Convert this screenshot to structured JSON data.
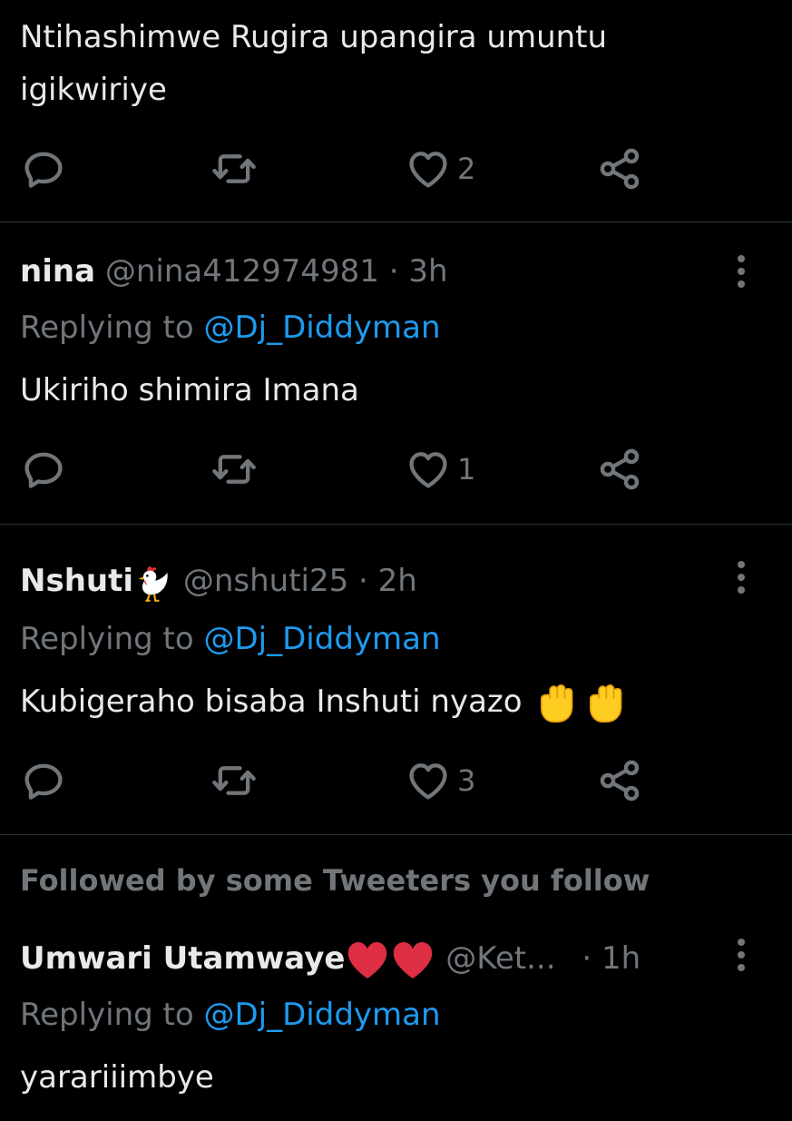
{
  "tweets": [
    {
      "body": "Ntihashimwe Rugira upangira umuntu",
      "body2": "igikwiriye",
      "like_count": "2"
    },
    {
      "name": "nina",
      "handle": "@nina412974981",
      "sep": "·",
      "time": "3h",
      "replying_label": "Replying to",
      "mention": "@Dj_Diddyman",
      "body": "Ukiriho shimira Imana",
      "like_count": "1"
    },
    {
      "name": "Nshuti",
      "name_emoji": "rooster",
      "handle": "@nshuti25",
      "sep": "·",
      "time": "2h",
      "replying_label": "Replying to",
      "mention": "@Dj_Diddyman",
      "body": "Kubigeraho bisaba Inshuti nyazo",
      "body_emoji": "raised-fist x2",
      "like_count": "3"
    }
  ],
  "section": {
    "title": "Followed by some Tweeters you follow"
  },
  "followed_tweet": {
    "name": "Umwari Utamwaye",
    "name_emoji": "red-heart x2",
    "handle": "@Ket...",
    "sep": "·",
    "time": "1h",
    "replying_label": "Replying to",
    "mention": "@Dj_Diddyman",
    "body": "yarariiimbye"
  },
  "icons": [
    "reply-icon",
    "retweet-icon",
    "like-icon",
    "share-icon",
    "more-icon"
  ],
  "colors": {
    "background": "#000000",
    "text": "#e7e9ea",
    "muted": "#71767b",
    "accent": "#1d9bf0",
    "divider": "#2f3336"
  }
}
